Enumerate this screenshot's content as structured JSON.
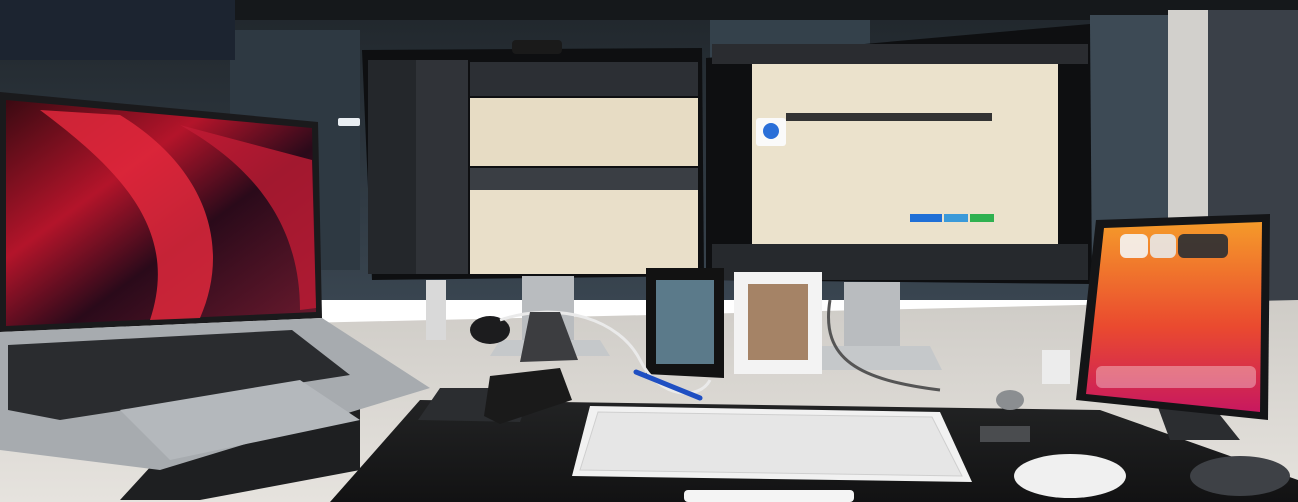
{
  "scene": {
    "description_free": true,
    "palette": {
      "wall": "#2a3138",
      "ceiling": "#1a1d20",
      "window": "#3a4650",
      "desk": "#d8d6d2",
      "mat": "#1b1b1c",
      "laptop_body": "#9ea2a6",
      "laptop_keys": "#2b2d30",
      "monitor_bezel": "#111214",
      "doc_bg": "#e9dfc9",
      "dark_ui": "#2b2e33",
      "keyboard_white": "#f2f2f2",
      "frame_black": "#111",
      "frame_white": "#f4f4f4",
      "ipad_wall1": "#f06a1f",
      "ipad_wall2": "#e0307a",
      "accent_blue": "#1f6fd6",
      "accent_green": "#2fb150"
    },
    "icons": [
      "laptop-icon",
      "monitor-left-icon",
      "monitor-right-icon",
      "ipad-icon",
      "keyboard-icon",
      "mouse-icon",
      "webcam-icon",
      "photo-frame-icon"
    ]
  }
}
